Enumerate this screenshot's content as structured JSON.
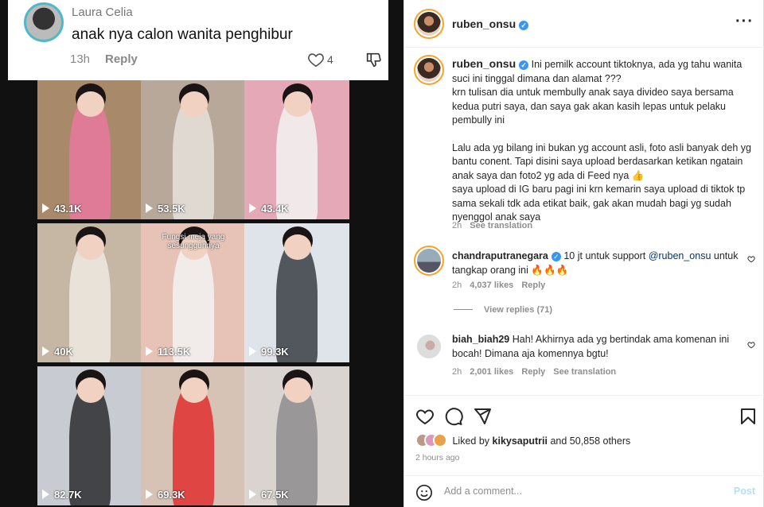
{
  "tiktok_comment": {
    "username": "Laura Celia",
    "text": "anak nya calon wanita penghibur",
    "time": "13h",
    "reply_label": "Reply",
    "likes": "4"
  },
  "video_grid": [
    {
      "views": "43.1K",
      "color": "#e9779f",
      "bg": "#a88a6b"
    },
    {
      "views": "53.5K",
      "color": "#e7e2da",
      "bg": "#b7a89a"
    },
    {
      "views": "43.4K",
      "color": "#f3f3f3",
      "bg": "#e5a8b7"
    },
    {
      "views": "40K",
      "color": "#efeae3",
      "bg": "#c6b7a4"
    },
    {
      "views": "113.5K",
      "color": "#f2f2f2",
      "bg": "#e7c2b7",
      "caption": "Fungsi meja yang sesungguhnya"
    },
    {
      "views": "99.3K",
      "color": "#3a3d44",
      "bg": "#dfe3ea"
    },
    {
      "views": "82.7K",
      "color": "#2b2b30",
      "bg": "#c8ccd2"
    },
    {
      "views": "69.3K",
      "color": "#e02f2f",
      "bg": "#d7c3b5"
    },
    {
      "views": "67.5K",
      "color": "#8d8c8e",
      "bg": "#d9d4cf"
    }
  ],
  "post": {
    "username": "ruben_onsu",
    "more_icon": "more-horizontal-icon",
    "caption_paragraphs": [
      "Ini pemilk account tiktoknya, ada yg tahu wanita suci ini tinggal dimana dan alamat ???",
      "krn tulisan dia untuk membully anak saya divideo saya bersama kedua putri saya, dan saya gak akan kasih lepas untuk pelaku pembully ini",
      "Lalu ada yg bilang ini bukan yg account asli, foto asli banyak deh yg bantu conent. Tapi disini saya upload berdasarkan ketikan ngatain anak saya dan foto2 yg ada di Feed nya 👍",
      "saya upload di IG baru pagi ini krn kemarin saya upload di tiktok tp sama sekali tdk ada etikat baik, gak akan mudah bagi yg sudah nyenggol anak saya"
    ],
    "caption_time": "2h",
    "see_translation": "See translation"
  },
  "comments": [
    {
      "username": "chandraputranegara",
      "text_before": "10 jt untuk support ",
      "mention": "@ruben_onsu",
      "text_after": " untuk tangkap orang ini 🔥🔥🔥",
      "time": "2h",
      "likes": "4,037 likes",
      "reply": "Reply",
      "view_replies": "View replies (71)"
    },
    {
      "username": "biah_biah29",
      "text": "Hah! Akhirnya ada yg bertindak ama komenan ini bocah! Dimana aja komennya bgtu!",
      "time": "2h",
      "likes": "2,001 likes",
      "reply": "Reply",
      "see_translation": "See translation"
    }
  ],
  "footer": {
    "liked_by_prefix": "Liked by ",
    "liked_by_user": "kikysaputrii",
    "liked_by_suffix": " and 50,858 others",
    "time_ago": "2 hours ago",
    "add_comment_placeholder": "Add a comment...",
    "post_label": "Post"
  }
}
